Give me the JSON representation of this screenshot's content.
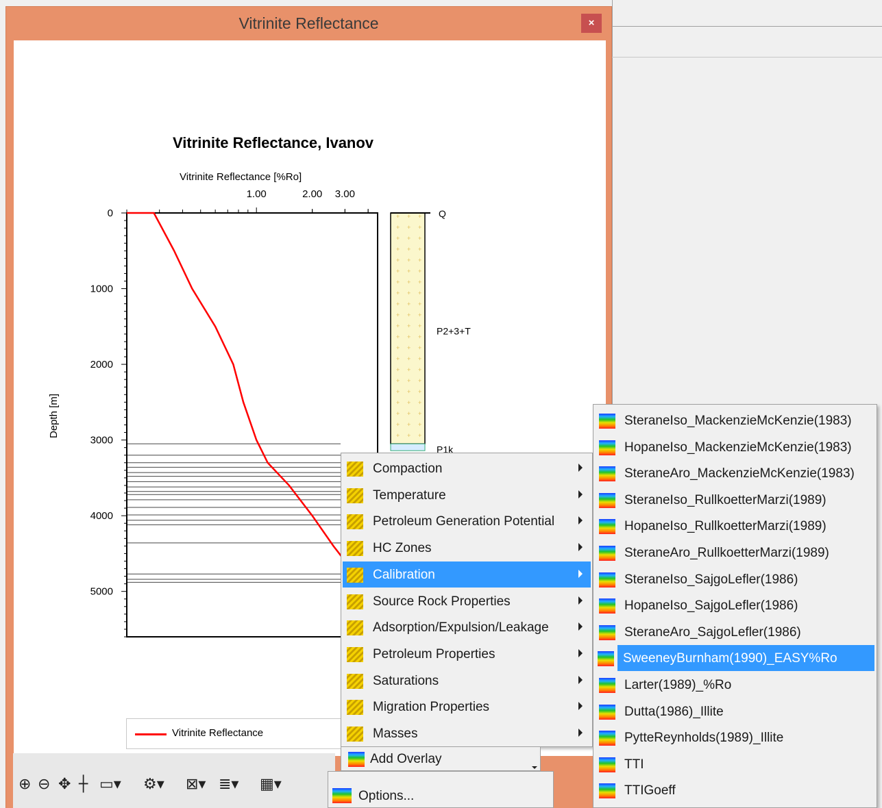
{
  "window": {
    "title": "Vitrinite Reflectance",
    "close_label": "×"
  },
  "chart_data": {
    "type": "line",
    "title": "Vitrinite Reflectance, Ivanov",
    "xlabel": "Vitrinite Reflectance [%Ro]",
    "ylabel": "Depth [m]",
    "x_scale": "log",
    "x_ticks": [
      "1.00",
      "2.00",
      "3.00"
    ],
    "y_ticks": [
      "0",
      "1000",
      "2000",
      "3000",
      "4000",
      "5000"
    ],
    "ylim": [
      0,
      5600
    ],
    "series": [
      {
        "name": "Vitrinite Reflectance",
        "color": "#ff0000",
        "points": [
          [
            0.2,
            0
          ],
          [
            0.28,
            0
          ],
          [
            0.36,
            500
          ],
          [
            0.45,
            1000
          ],
          [
            0.6,
            1500
          ],
          [
            0.75,
            2000
          ],
          [
            0.85,
            2500
          ],
          [
            1.0,
            3000
          ],
          [
            1.15,
            3300
          ],
          [
            1.5,
            3600
          ],
          [
            2.0,
            4000
          ],
          [
            2.6,
            4400
          ],
          [
            2.9,
            4550
          ]
        ]
      }
    ],
    "horizon_depths": [
      3050,
      3200,
      3300,
      3360,
      3430,
      3480,
      3550,
      3620,
      3680,
      3720,
      3790,
      3890,
      3990,
      4060,
      4120,
      4360,
      4770,
      4840,
      4880
    ],
    "zones": [
      {
        "label": "Q",
        "top": 0,
        "color": "#fbf7cc"
      },
      {
        "label": "P2+3+T",
        "top": 10,
        "color": "#fbf7cc"
      },
      {
        "label": "P1k",
        "top": 3050,
        "color": "#d6ecff"
      }
    ],
    "legend": "bottom-left"
  },
  "legend": {
    "label": "Vitrinite Reflectance"
  },
  "menu": {
    "items": [
      {
        "label": "Compaction",
        "icon": "grid-yellow-icon"
      },
      {
        "label": "Temperature",
        "icon": "grid-yellow-icon"
      },
      {
        "label": "Petroleum Generation Potential",
        "icon": "grid-yellow-icon"
      },
      {
        "label": "HC Zones",
        "icon": "grid-yellow-icon"
      },
      {
        "label": "Calibration",
        "icon": "grid-yellow-icon"
      },
      {
        "label": "Source Rock Properties",
        "icon": "grid-yellow-icon"
      },
      {
        "label": "Adsorption/Expulsion/Leakage",
        "icon": "grid-yellow-icon"
      },
      {
        "label": "Petroleum Properties",
        "icon": "grid-yellow-icon"
      },
      {
        "label": "Saturations",
        "icon": "grid-yellow-icon"
      },
      {
        "label": "Migration Properties",
        "icon": "grid-yellow-icon"
      },
      {
        "label": "Masses",
        "icon": "grid-yellow-icon"
      }
    ],
    "add_overlay": "Add Overlay",
    "options": "Options..."
  },
  "submenu": {
    "items": [
      {
        "label": "SteraneIso_MackenzieMcKenzie(1983)"
      },
      {
        "label": "HopaneIso_MackenzieMcKenzie(1983)"
      },
      {
        "label": "SteraneAro_MackenzieMcKenzie(1983)"
      },
      {
        "label": "SteraneIso_RullkoetterMarzi(1989)"
      },
      {
        "label": "HopaneIso_RullkoetterMarzi(1989)"
      },
      {
        "label": "SteraneAro_RullkoetterMarzi(1989)"
      },
      {
        "label": "SteraneIso_SajgoLefler(1986)"
      },
      {
        "label": "HopaneIso_SajgoLefler(1986)"
      },
      {
        "label": "SteraneAro_SajgoLefler(1986)"
      },
      {
        "label": "SweeneyBurnham(1990)_EASY%Ro"
      },
      {
        "label": "Larter(1989)_%Ro"
      },
      {
        "label": "Dutta(1986)_Illite"
      },
      {
        "label": "PytteReynholds(1989)_Illite"
      },
      {
        "label": "TTI"
      },
      {
        "label": "TTIGoeff"
      }
    ]
  },
  "toolbar": {
    "icons": [
      "zoom-in-icon",
      "zoom-out-icon",
      "pan-icon",
      "crosshair-icon",
      "rectangle-select-icon",
      "settings-icon",
      "annotation-icon",
      "legend-icon",
      "overlay-icon"
    ]
  },
  "colors": {
    "window_frame": "#e8916a",
    "selection": "#3399ff",
    "curve": "#ff0000"
  }
}
